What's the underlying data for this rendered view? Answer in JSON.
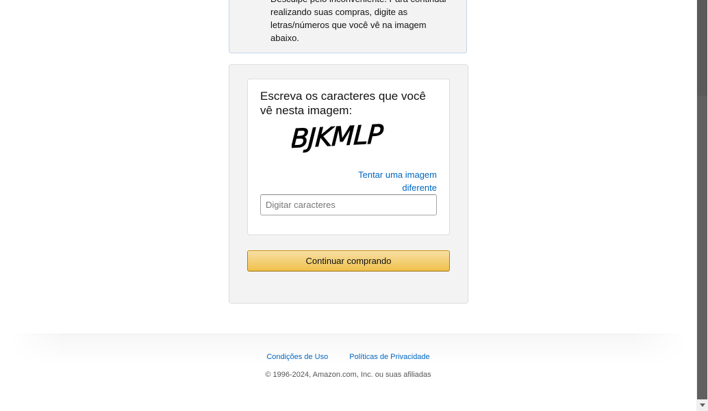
{
  "alert": {
    "text_line_0": "Desculpe pelo inconveniente. Para continuar",
    "text_line_1": "realizando suas compras, digite as",
    "text_line_2": "letras/números que você vê na imagem",
    "text_line_3": "abaixo."
  },
  "captcha": {
    "heading": "Escreva os caracteres que você vê nesta imagem:",
    "image_text": "BJKMLP",
    "retry_label": "Tentar uma imagem diferente",
    "input_placeholder": "Digitar caracteres",
    "input_value": "",
    "submit_label": "Continuar comprando"
  },
  "footer": {
    "conditions_label": "Condições de Uso",
    "privacy_label": "Políticas de Privacidade",
    "copyright": "© 1996-2024, Amazon.com, Inc. ou suas afiliadas"
  },
  "colors": {
    "link": "#0066c0",
    "button_top": "#f7dfa5",
    "button_bottom": "#f0c14b",
    "panel_bg": "#f3f3f3"
  }
}
